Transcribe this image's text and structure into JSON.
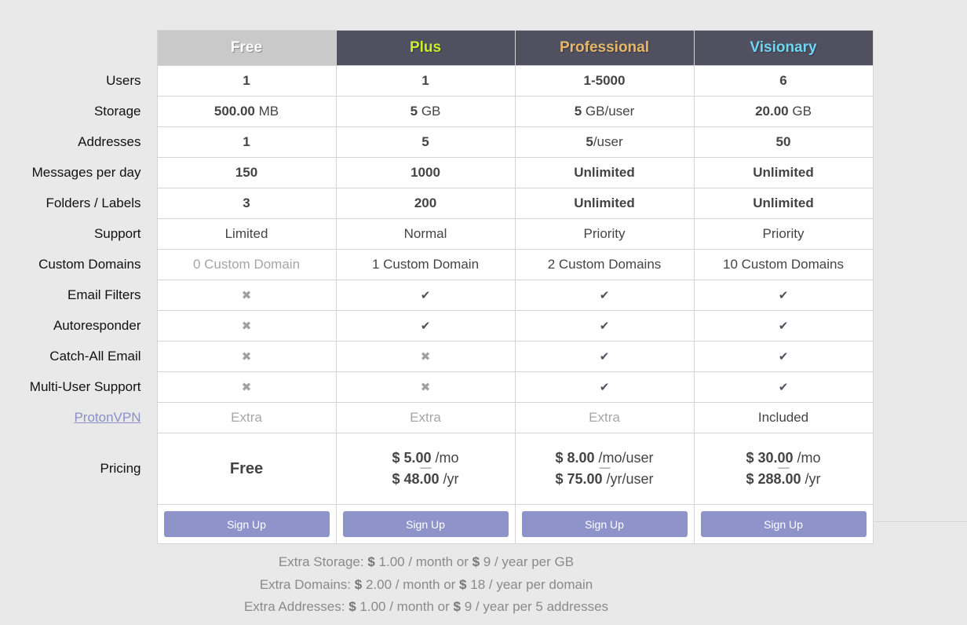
{
  "plans": [
    {
      "name": "Free",
      "color": "#ffffff",
      "price_free": "Free"
    },
    {
      "name": "Plus",
      "color": "#c8ee29",
      "monthly": "5.00",
      "monthly_unit": "/mo",
      "yearly": "48.00",
      "yearly_unit": "/yr"
    },
    {
      "name": "Professional",
      "color": "#e6b86a",
      "monthly": "8.00",
      "monthly_unit": "/mo/user",
      "yearly": "75.00",
      "yearly_unit": "/yr/user"
    },
    {
      "name": "Visionary",
      "color": "#6fd6f2",
      "monthly": "30.00",
      "monthly_unit": "/mo",
      "yearly": "288.00",
      "yearly_unit": "/yr"
    }
  ],
  "rows": {
    "users": {
      "label": "Users",
      "values": [
        "1",
        "1",
        "1-5000",
        "6"
      ]
    },
    "storage": {
      "label": "Storage",
      "values": [
        "500.00",
        "5",
        "5",
        "20.00"
      ],
      "units": [
        "MB",
        "GB",
        "GB/user",
        "GB"
      ]
    },
    "addresses": {
      "label": "Addresses",
      "values": [
        "1",
        "5",
        "5",
        "50"
      ],
      "units": [
        "",
        "",
        "/user",
        ""
      ]
    },
    "messages": {
      "label": "Messages per day",
      "values": [
        "150",
        "1000",
        "Unlimited",
        "Unlimited"
      ]
    },
    "folders": {
      "label": "Folders / Labels",
      "values": [
        "3",
        "200",
        "Unlimited",
        "Unlimited"
      ]
    },
    "support": {
      "label": "Support",
      "values": [
        "Limited",
        "Normal",
        "Priority",
        "Priority"
      ]
    },
    "domains": {
      "label": "Custom Domains",
      "values": [
        "0 Custom Domain",
        "1 Custom Domain",
        "2 Custom Domains",
        "10 Custom Domains"
      ]
    },
    "filters": {
      "label": "Email Filters",
      "icons": [
        "cross-icon",
        "check-icon",
        "check-icon",
        "check-icon"
      ]
    },
    "autoresponder": {
      "label": "Autoresponder",
      "icons": [
        "cross-icon",
        "check-icon",
        "check-icon",
        "check-icon"
      ]
    },
    "catchall": {
      "label": "Catch-All Email",
      "icons": [
        "cross-icon",
        "cross-icon",
        "check-icon",
        "check-icon"
      ]
    },
    "multiuser": {
      "label": "Multi-User Support",
      "icons": [
        "cross-icon",
        "cross-icon",
        "check-icon",
        "check-icon"
      ]
    },
    "vpn": {
      "label": "ProtonVPN",
      "values": [
        "Extra",
        "Extra",
        "Extra",
        "Included"
      ]
    }
  },
  "pricing": {
    "label": "Pricing",
    "currency": "$",
    "separator": "------"
  },
  "signup_label": "Sign Up",
  "glyphs": {
    "check": "✔",
    "cross": "✖"
  },
  "footer": {
    "storage": {
      "label": "Extra Storage:",
      "currency": "$",
      "text": "1.00 / month or",
      "currency2": "$",
      "text2": "9 / year per GB"
    },
    "domains": {
      "label": "Extra Domains:",
      "currency": "$",
      "text": "2.00 / month or",
      "currency2": "$",
      "text2": "18 / year per domain"
    },
    "addresses": {
      "label": "Extra Addresses:",
      "currency": "$",
      "text": "1.00 / month or",
      "currency2": "$",
      "text2": "9 / year per 5 addresses"
    }
  }
}
